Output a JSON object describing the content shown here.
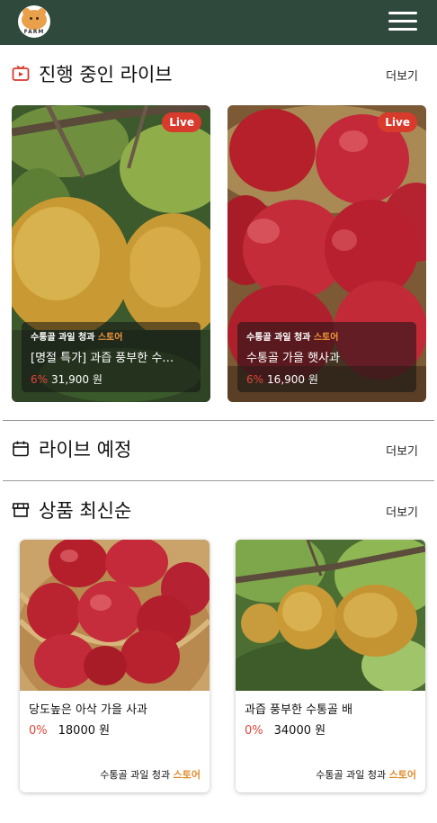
{
  "header": {
    "logo_text": "FARM",
    "logo_icon": "bear-logo-icon",
    "menu_icon": "hamburger-menu-icon"
  },
  "live_now": {
    "title": "진행 중인 라이브",
    "more": "더보기",
    "icon": "tv-icon",
    "cards": [
      {
        "badge": "Live",
        "store_name": "수통골 과일 청과",
        "store_suffix": "스토어",
        "title": "[명절 특가] 과즙 풍부한 수…",
        "discount": "6%",
        "price": "31,900 원",
        "image": "pear"
      },
      {
        "badge": "Live",
        "store_name": "수통골 과일 청과",
        "store_suffix": "스토어",
        "title": "수통골 가을 햇사과",
        "discount": "6%",
        "price": "16,900 원",
        "image": "apple"
      }
    ]
  },
  "upcoming": {
    "title": "라이브 예정",
    "more": "더보기",
    "icon": "calendar-icon"
  },
  "latest": {
    "title": "상품 최신순",
    "more": "더보기",
    "icon": "store-icon",
    "products": [
      {
        "name": "당도높은 아삭 가을 사과",
        "discount": "0%",
        "price": "18000 원",
        "store_name": "수통골 과일 청과",
        "store_suffix": "스토어",
        "image": "apple"
      },
      {
        "name": "과즙 풍부한 수통골 배",
        "discount": "0%",
        "price": "34000 원",
        "store_name": "수통골 과일 청과",
        "store_suffix": "스토어",
        "image": "pear"
      }
    ]
  },
  "colors": {
    "header_bg": "#2f4a3c",
    "live_badge": "#d83a2c",
    "discount": "#e0453a",
    "store_accent": "#e08a2c"
  }
}
